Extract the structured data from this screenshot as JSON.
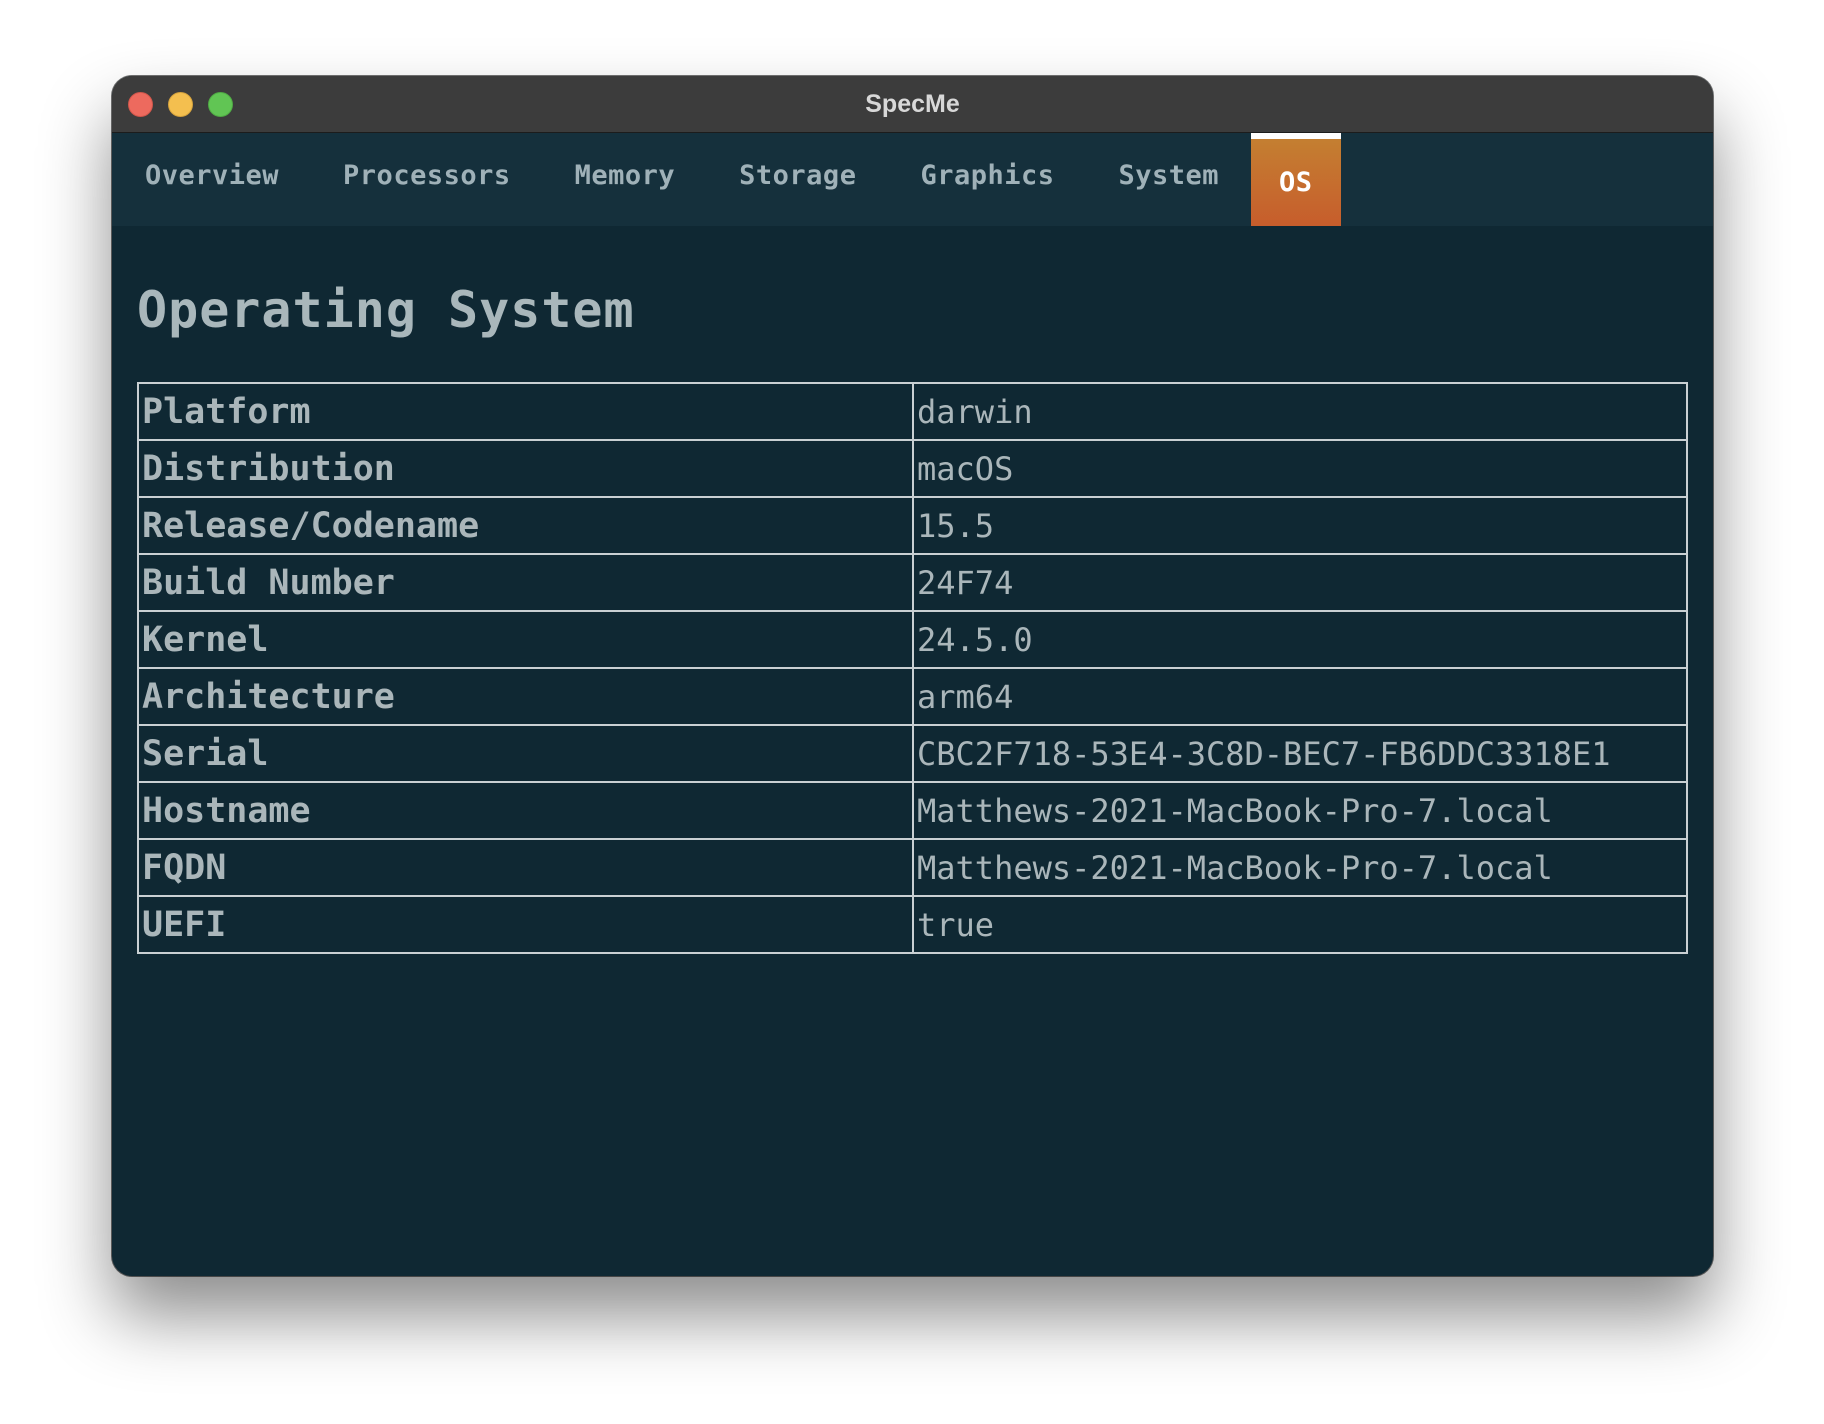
{
  "window": {
    "title": "SpecMe"
  },
  "tabs": [
    {
      "label": "Overview",
      "active": false
    },
    {
      "label": "Processors",
      "active": false
    },
    {
      "label": "Memory",
      "active": false
    },
    {
      "label": "Storage",
      "active": false
    },
    {
      "label": "Graphics",
      "active": false
    },
    {
      "label": "System",
      "active": false
    },
    {
      "label": "OS",
      "active": true
    }
  ],
  "page": {
    "title": "Operating System"
  },
  "rows": [
    {
      "key": "Platform",
      "value": "darwin"
    },
    {
      "key": "Distribution",
      "value": "macOS"
    },
    {
      "key": "Release/Codename",
      "value": "15.5"
    },
    {
      "key": "Build Number",
      "value": "24F74"
    },
    {
      "key": "Kernel",
      "value": "24.5.0"
    },
    {
      "key": "Architecture",
      "value": "arm64"
    },
    {
      "key": "Serial",
      "value": "CBC2F718-53E4-3C8D-BEC7-FB6DDC3318E1"
    },
    {
      "key": "Hostname",
      "value": "Matthews-2021-MacBook-Pro-7.local"
    },
    {
      "key": "FQDN",
      "value": "Matthews-2021-MacBook-Pro-7.local"
    },
    {
      "key": "UEFI",
      "value": "true"
    }
  ],
  "colors": {
    "background": "#0f2833",
    "tabbar": "#15303c",
    "active_tab_top": "#c47f31",
    "active_tab_bottom": "#c75d2c",
    "text": "#aab6ba"
  }
}
